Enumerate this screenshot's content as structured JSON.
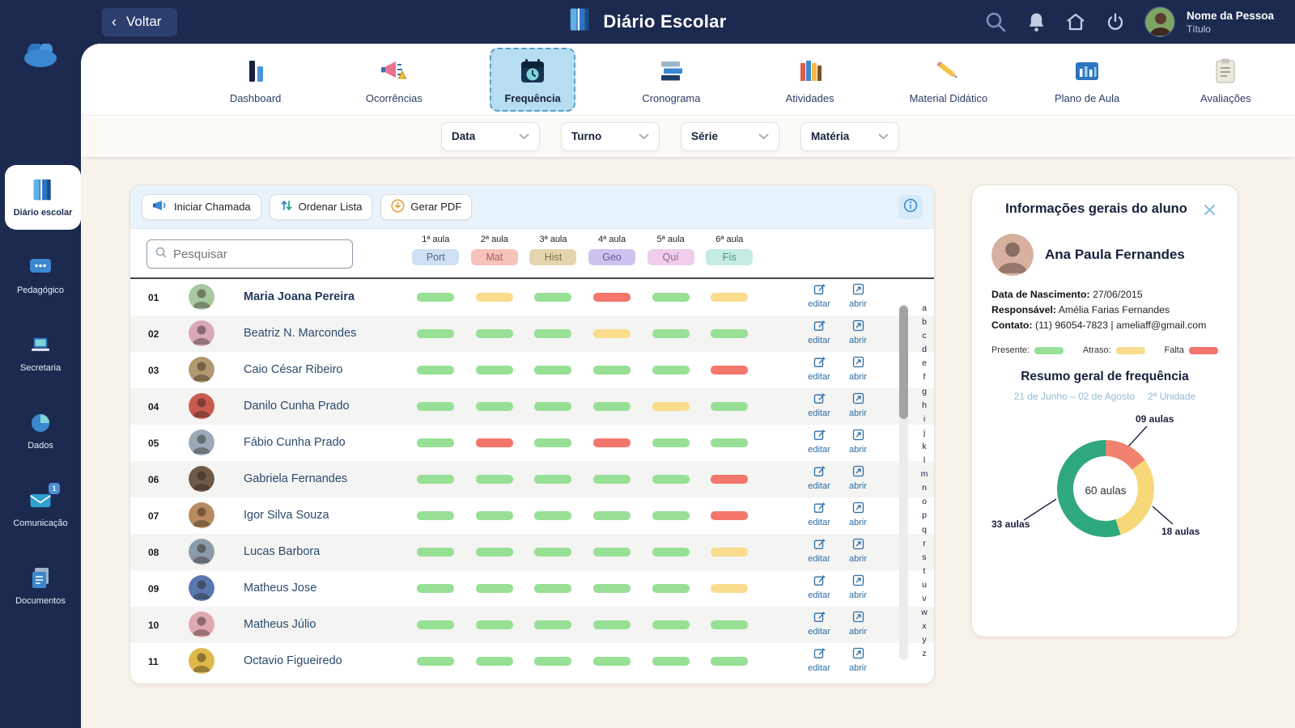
{
  "topbar": {
    "back_label": "Voltar",
    "app_title": "Diário Escolar",
    "user_name": "Nome da Pessoa",
    "user_title": "Título"
  },
  "sidebar": {
    "items": [
      {
        "label": "Diário escolar",
        "icon": "book-icon",
        "active": true
      },
      {
        "label": "Pedagógico",
        "icon": "chat-icon"
      },
      {
        "label": "Secretaria",
        "icon": "laptop-icon"
      },
      {
        "label": "Dados",
        "icon": "pie-icon"
      },
      {
        "label": "Comunicação",
        "icon": "mail-icon",
        "badge": "1"
      },
      {
        "label": "Documentos",
        "icon": "docs-icon"
      }
    ]
  },
  "tabs": [
    {
      "label": "Dashboard",
      "icon": "dashboard-icon"
    },
    {
      "label": "Ocorrências",
      "icon": "megaphone-alert-icon"
    },
    {
      "label": "Frequência",
      "icon": "calendar-clock-icon",
      "active": true
    },
    {
      "label": "Cronograma",
      "icon": "books-stack-icon"
    },
    {
      "label": "Atividades",
      "icon": "books-row-icon"
    },
    {
      "label": "Material Didático",
      "icon": "pencil-icon"
    },
    {
      "label": "Plano de Aula",
      "icon": "chart-board-icon"
    },
    {
      "label": "Avaliações",
      "icon": "clipboard-icon"
    }
  ],
  "filters": [
    {
      "label": "Data"
    },
    {
      "label": "Turno"
    },
    {
      "label": "Série"
    },
    {
      "label": "Matéria"
    }
  ],
  "toolbar": {
    "start_call": "Iniciar Chamada",
    "sort_list": "Ordenar Lista",
    "generate_pdf": "Gerar PDF"
  },
  "attendance": {
    "search_placeholder": "Pesquisar",
    "lesson_headers": [
      "1ª aula",
      "2ª aula",
      "3ª aula",
      "4ª aula",
      "5ª aula",
      "6ª aula"
    ],
    "subjects": [
      {
        "label": "Port",
        "bg": "#cfe0f2",
        "fg": "#44688f"
      },
      {
        "label": "Mat",
        "bg": "#f6c3ba",
        "fg": "#b05a4e"
      },
      {
        "label": "Hist",
        "bg": "#e4d5af",
        "fg": "#86703c"
      },
      {
        "label": "Geo",
        "bg": "#cfc2ef",
        "fg": "#6a55a8"
      },
      {
        "label": "Quí",
        "bg": "#eeceea",
        "fg": "#9c5f96"
      },
      {
        "label": "Fís",
        "bg": "#c5ebe3",
        "fg": "#44948a"
      }
    ],
    "status_colors": {
      "presente": "#97e095",
      "atraso": "#f9dd8d",
      "falta": "#f4766c"
    },
    "actions": {
      "edit": "editar",
      "open": "abrir"
    },
    "alphabet": "abcdefghijklmnopqrstuvwxyz",
    "rows": [
      {
        "num": "01",
        "name": "Maria Joana Pereira",
        "bold": true,
        "avatar_color": "#a8c8a0",
        "statuses": [
          "presente",
          "atraso",
          "presente",
          "falta",
          "presente",
          "atraso"
        ]
      },
      {
        "num": "02",
        "name": "Beatriz N. Marcondes",
        "avatar_color": "#d8a8b8",
        "statuses": [
          "presente",
          "presente",
          "presente",
          "atraso",
          "presente",
          "presente"
        ]
      },
      {
        "num": "03",
        "name": "Caio César Ribeiro",
        "avatar_color": "#b0986f",
        "statuses": [
          "presente",
          "presente",
          "presente",
          "presente",
          "presente",
          "falta"
        ]
      },
      {
        "num": "04",
        "name": "Danilo Cunha Prado",
        "avatar_color": "#c85a50",
        "statuses": [
          "presente",
          "presente",
          "presente",
          "presente",
          "atraso",
          "presente"
        ]
      },
      {
        "num": "05",
        "name": "Fábio Cunha Prado",
        "avatar_color": "#9aa8b8",
        "statuses": [
          "presente",
          "falta",
          "presente",
          "falta",
          "presente",
          "presente"
        ]
      },
      {
        "num": "06",
        "name": "Gabriela Fernandes",
        "avatar_color": "#6f5a48",
        "statuses": [
          "presente",
          "presente",
          "presente",
          "presente",
          "presente",
          "falta"
        ]
      },
      {
        "num": "07",
        "name": "Igor Silva Souza",
        "avatar_color": "#b88a60",
        "statuses": [
          "presente",
          "presente",
          "presente",
          "presente",
          "presente",
          "falta"
        ]
      },
      {
        "num": "08",
        "name": "Lucas Barbora",
        "avatar_color": "#8a9aa8",
        "statuses": [
          "presente",
          "presente",
          "presente",
          "presente",
          "presente",
          "atraso"
        ]
      },
      {
        "num": "09",
        "name": "Matheus Jose",
        "avatar_color": "#5a78b0",
        "statuses": [
          "presente",
          "presente",
          "presente",
          "presente",
          "presente",
          "atraso"
        ]
      },
      {
        "num": "10",
        "name": "Matheus Júlio",
        "avatar_color": "#e0a8b0",
        "statuses": [
          "presente",
          "presente",
          "presente",
          "presente",
          "presente",
          "presente"
        ]
      },
      {
        "num": "11",
        "name": "Octavio Figueiredo",
        "avatar_color": "#e0b84a",
        "statuses": [
          "presente",
          "presente",
          "presente",
          "presente",
          "presente",
          "presente"
        ]
      }
    ]
  },
  "student_panel": {
    "title": "Informações gerais do aluno",
    "student_name": "Ana Paula Fernandes",
    "avatar_color": "#d8b0a0",
    "birth_label": "Data de Nascimento:",
    "birth_value": "27/06/2015",
    "guardian_label": "Responsável:",
    "guardian_value": "Amélia Farias Fernandes",
    "contact_label": "Contato:",
    "contact_value": "(11) 96054-7823 | ameliaff@gmail.com",
    "legend": [
      {
        "label": "Presente:",
        "color": "#97e095"
      },
      {
        "label": "Atraso:",
        "color": "#f9dd8d"
      },
      {
        "label": "Falta",
        "color": "#f4766c"
      }
    ],
    "summary_title": "Resumo geral de frequência",
    "period": "21 de Junho – 02 de Agosto",
    "unit": "2ª Unidade"
  },
  "chart_data": {
    "type": "pie",
    "title": "Resumo geral de frequência",
    "labels": [
      "Falta",
      "Atraso",
      "Presente"
    ],
    "values": [
      9,
      18,
      33
    ],
    "value_labels": [
      "09 aulas",
      "18 aulas",
      "33 aulas"
    ],
    "colors": [
      "#f0816f",
      "#f6d878",
      "#2fa87e"
    ],
    "total": 60,
    "center_label": "60 aulas",
    "legend_position": "outside-callouts"
  }
}
